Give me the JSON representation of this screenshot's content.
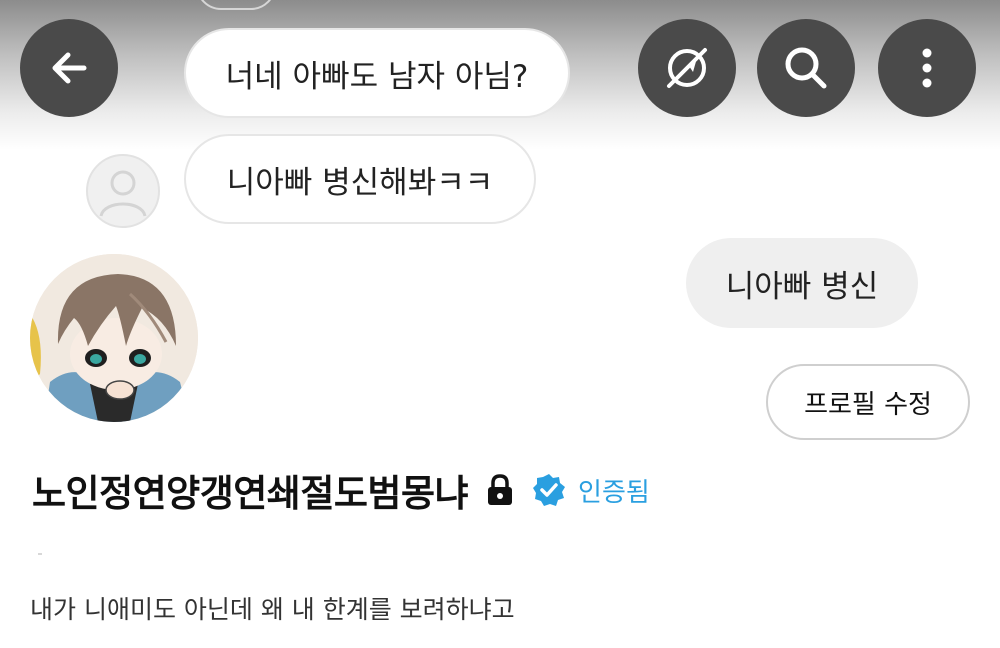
{
  "header": {
    "back_icon": "arrow-left-icon",
    "actions": [
      "no-compass-icon",
      "search-icon",
      "more-vertical-icon"
    ]
  },
  "chat": {
    "message_1": "너네 아빠도 남자 아님?",
    "message_2": "니아빠 병신해봐ㅋㅋ",
    "message_3": "니아빠 병신"
  },
  "profile": {
    "edit_label": "프로필 수정",
    "name": "노인정연양갱연쇄절도범몽냐",
    "lock_icon": "lock-icon",
    "verified_icon": "verified-badge-icon",
    "verified_label": "인증됨",
    "bio": "내가 니애미도 아닌데 왜 내 한계를 보려하냐고"
  },
  "colors": {
    "button_bg": "#4a4a4a",
    "verified_blue": "#2a9fe0",
    "bubble_bg": "#f2f2f2"
  }
}
